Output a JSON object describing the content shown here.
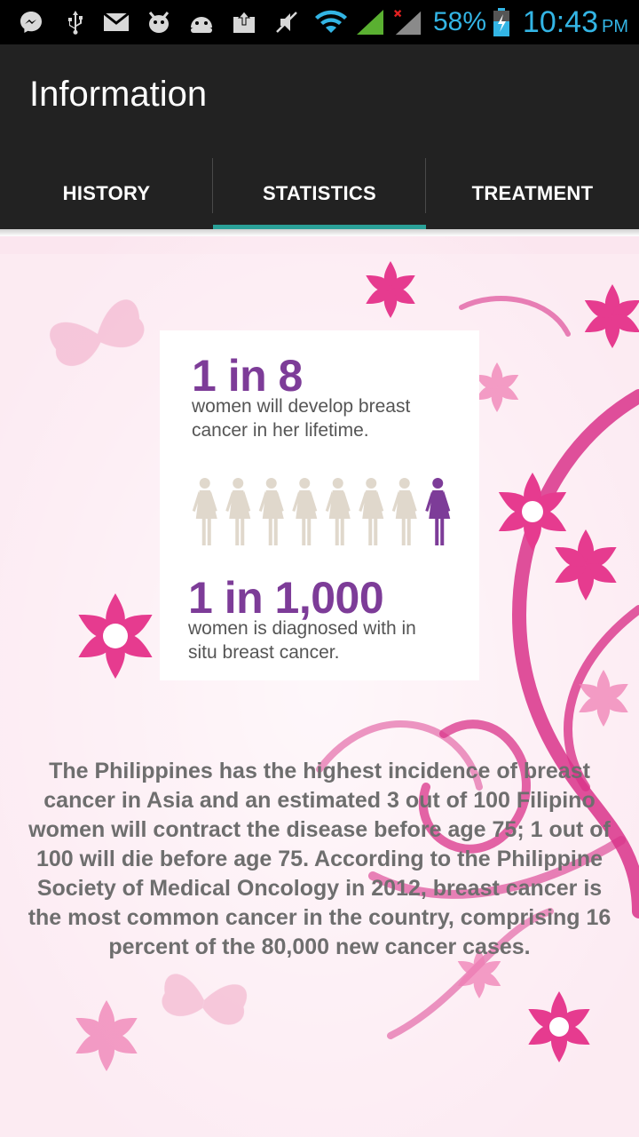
{
  "status_bar": {
    "icons": [
      "messenger-icon",
      "usb-icon",
      "gmail-icon",
      "bug-icon",
      "android-icon",
      "upload-icon",
      "mute-icon",
      "wifi-icon",
      "signal-icon",
      "no-signal-icon"
    ],
    "battery_percent": "58%",
    "time": "10:43",
    "ampm": "PM"
  },
  "action_bar": {
    "title": "Information"
  },
  "tabs": [
    {
      "label": "HISTORY",
      "selected": false
    },
    {
      "label": "STATISTICS",
      "selected": true
    },
    {
      "label": "TREATMENT",
      "selected": false
    }
  ],
  "colors": {
    "accent": "#2aa198",
    "stat_purple": "#7d3c98",
    "action_bar": "#222222",
    "status_text": "#33b5e5",
    "flower_pink": "#e63b8f"
  },
  "infographic": {
    "stat1_value": "1 in 8",
    "stat1_desc_line1": "women will develop breast",
    "stat1_desc_line2": "cancer in her lifetime.",
    "figures_total": 8,
    "figures_highlighted": 1,
    "stat2_value": "1 in 1,000",
    "stat2_desc_line1": "women is diagnosed with in",
    "stat2_desc_line2": "situ breast cancer."
  },
  "body_text": "The Philippines has the highest incidence of breast cancer in Asia and an estimated 3 out of 100 Filipino women will contract the disease before age 75; 1 out of 100 will die before age 75. According to the Philippine Society of Medical Oncology in 2012, breast cancer is the most common cancer in the country, comprising 16 percent of the 80,000 new cancer cases."
}
